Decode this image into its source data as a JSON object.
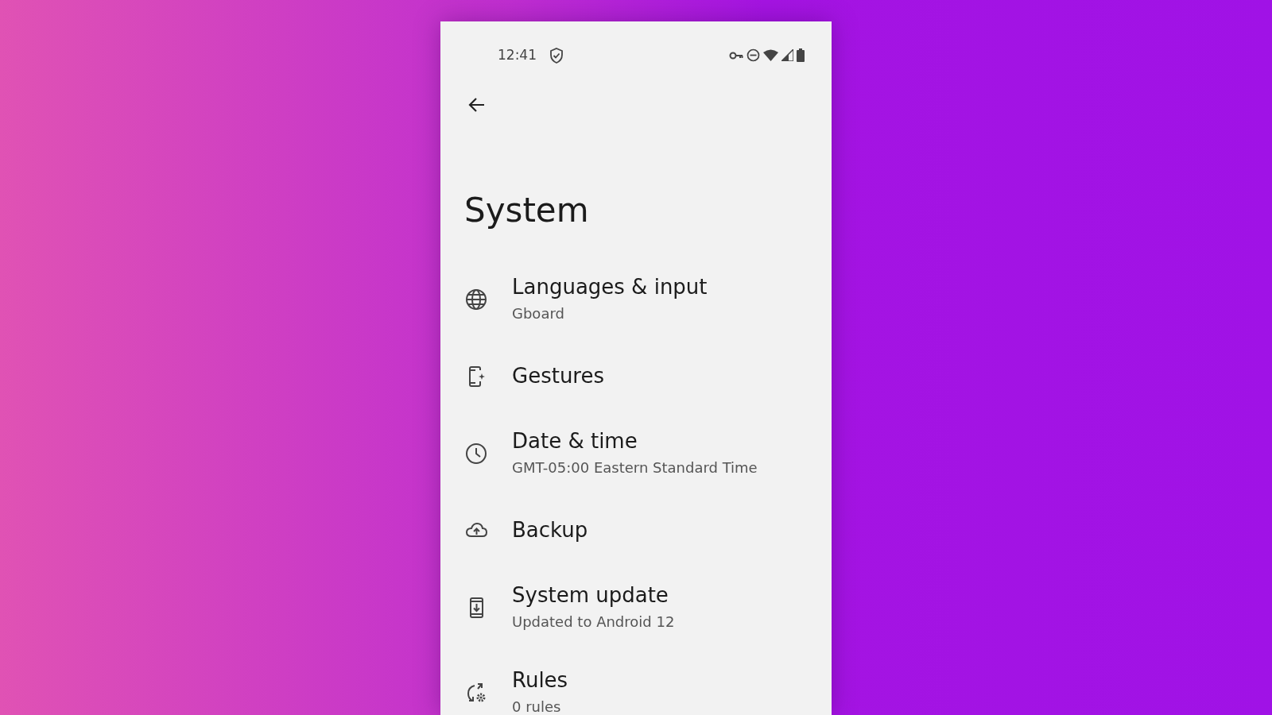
{
  "status_bar": {
    "time": "12:41"
  },
  "page": {
    "title": "System"
  },
  "items": [
    {
      "title": "Languages & input",
      "subtitle": "Gboard"
    },
    {
      "title": "Gestures"
    },
    {
      "title": "Date & time",
      "subtitle": "GMT-05:00 Eastern Standard Time"
    },
    {
      "title": "Backup"
    },
    {
      "title": "System update",
      "subtitle": "Updated to Android 12"
    },
    {
      "title": "Rules",
      "subtitle": "0 rules"
    }
  ]
}
